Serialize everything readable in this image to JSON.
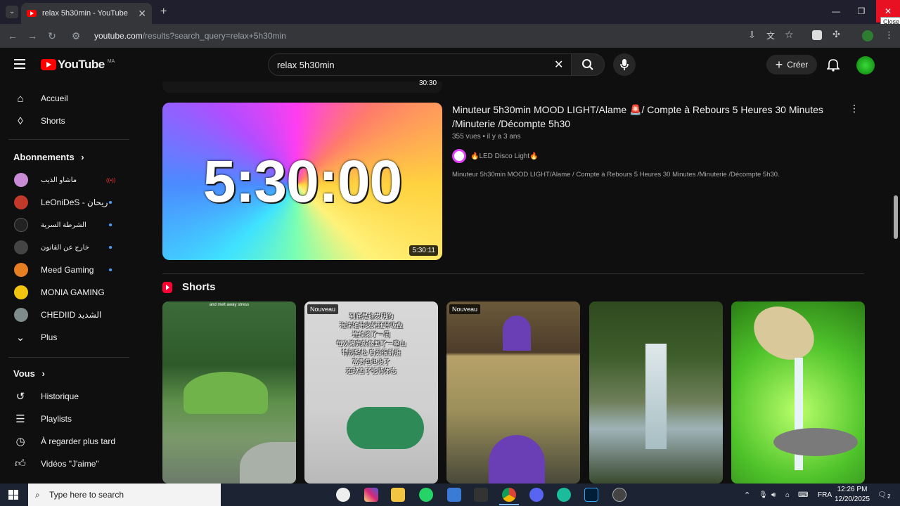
{
  "browser": {
    "tab_title": "relax 5h30min - YouTube",
    "tab_close": "✕",
    "new_tab": "+",
    "url_host": "youtube.com",
    "url_path": "/results?search_query=relax+5h30min",
    "close_tooltip": "Close"
  },
  "header": {
    "logo_text": "YouTube",
    "logo_region": "MA",
    "search_value": "relax 5h30min",
    "create_label": "Créer"
  },
  "sidebar": {
    "home": "Accueil",
    "shorts": "Shorts",
    "subscriptions_heading": "Abonnements",
    "channels": [
      {
        "name": "ماشاو الذيب",
        "color": "#c98bd6"
      },
      {
        "name": "LeOniDeS - ن ريحان",
        "color": "#c0392b"
      },
      {
        "name": "الشرطة السرية",
        "color": "#222222"
      },
      {
        "name": "خارج عن القانون",
        "color": "#444444"
      },
      {
        "name": "Meed Gaming",
        "color": "#e67e22"
      },
      {
        "name": "MONIA GAMING",
        "color": "#f1c40f"
      },
      {
        "name": "CHEDIID الشديد",
        "color": "#7f8c8d"
      }
    ],
    "more": "Plus",
    "you_heading": "Vous",
    "history": "Historique",
    "playlists": "Playlists",
    "watch_later": "À regarder plus tard",
    "liked": "Vidéos \"J'aime\""
  },
  "results": {
    "prev_duration": "30:30",
    "video": {
      "thumb_text": "5:30:00",
      "duration": "5:30:11",
      "title": "Minuteur 5h30min MOOD LIGHT/Alame 🚨/ Compte à Rebours 5 Heures 30 Minutes /Minuterie /Décompte 5h30",
      "meta": "355 vues • il y a 3 ans",
      "channel": "🔥LED Disco Light🔥",
      "description": "Minuteur 5h30min MOOD LIGHT/Alame / Compte à Rebours 5 Heures 30 Minutes /Minuterie /Décompte 5h30."
    }
  },
  "shorts": {
    "heading": "Shorts",
    "items": [
      {
        "caption": "and melt away stress",
        "badge": ""
      },
      {
        "caption": "到底是谁发明的\n泡沫轴带支架还带吸盘\n连续滚了一周\n每次滚完就像卸了一座山\n特别轻松 肩颈很舒服\n富贵包也没了\n还改善了驼背体态",
        "badge": "Nouveau"
      },
      {
        "caption": "",
        "badge": "Nouveau"
      },
      {
        "caption": "",
        "badge": ""
      },
      {
        "caption": "",
        "badge": ""
      }
    ]
  },
  "taskbar": {
    "search_placeholder": "Type here to search",
    "language": "FRA",
    "time": "12:26 PM",
    "date": "12/20/2025",
    "notif_count": "2"
  },
  "icons": [
    "menu-icon",
    "search-icon",
    "mic-icon",
    "bell-icon",
    "home-icon",
    "shorts-icon",
    "history-icon",
    "playlist-icon",
    "clock-icon",
    "thumbs-up-icon"
  ]
}
